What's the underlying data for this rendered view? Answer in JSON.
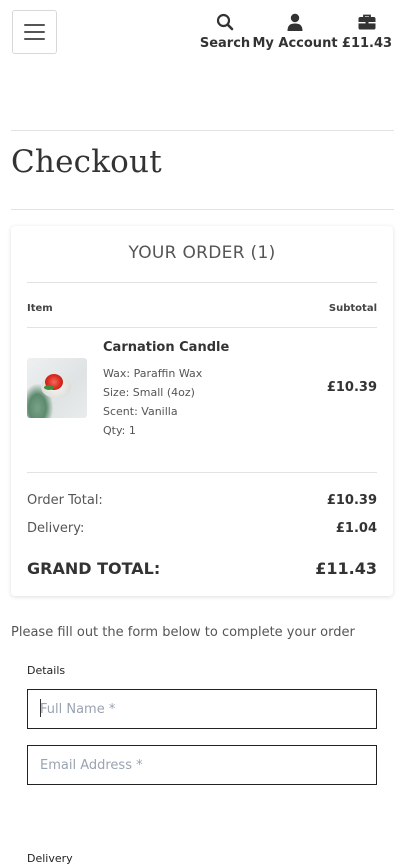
{
  "header": {
    "menu_icon": "hamburger-menu-icon",
    "nav": [
      {
        "label": "Search",
        "icon": "search-icon"
      },
      {
        "label": "My Account",
        "icon": "user-icon"
      },
      {
        "label": "£11.43",
        "icon": "briefcase-bag-icon"
      }
    ]
  },
  "page": {
    "title": "Checkout"
  },
  "order": {
    "heading": "YOUR ORDER (1)",
    "columns": {
      "item": "Item",
      "subtotal": "Subtotal"
    },
    "items": [
      {
        "name": "Carnation Candle",
        "wax": "Wax: Paraffin Wax",
        "size": "Size: Small (4oz)",
        "scent": "Scent: Vanilla",
        "qty": "Qty: 1",
        "price": "£10.39"
      }
    ],
    "totals": {
      "order_total_label": "Order Total:",
      "order_total": "£10.39",
      "delivery_label": "Delivery:",
      "delivery": "£1.04",
      "grand_total_label": "GRAND TOTAL:",
      "grand_total": "£11.43"
    }
  },
  "form": {
    "intro": "Please fill out the form below to complete your order",
    "details_legend": "Details",
    "full_name_placeholder": "Full Name *",
    "email_placeholder": "Email Address *",
    "delivery_legend": "Delivery"
  },
  "colors": {
    "text": "#333333",
    "muted": "#555555",
    "placeholder": "#9aa3b0",
    "border": "#222222"
  }
}
